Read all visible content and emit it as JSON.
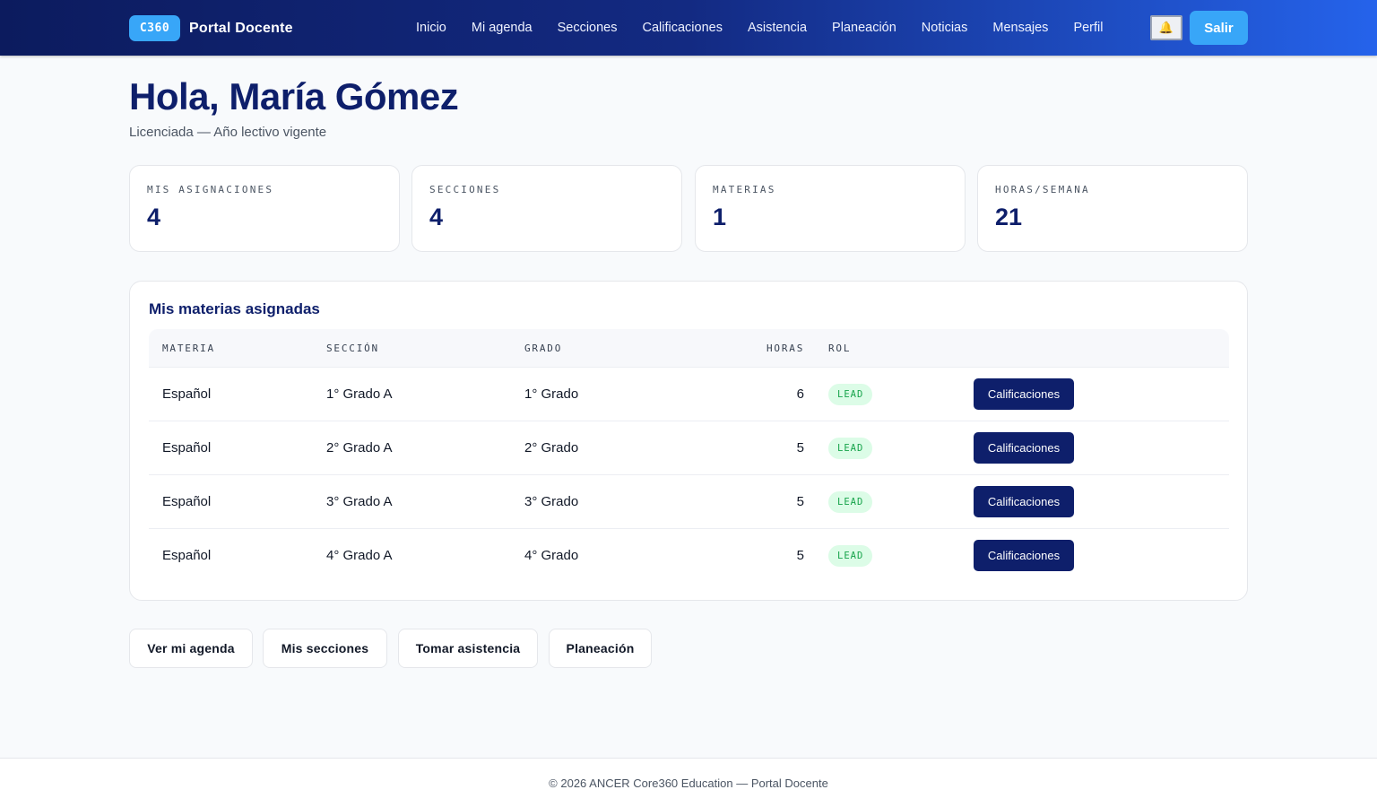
{
  "header": {
    "brand_badge": "C360",
    "brand_title": "Portal Docente",
    "nav": [
      "Inicio",
      "Mi agenda",
      "Secciones",
      "Calificaciones",
      "Asistencia",
      "Planeación",
      "Noticias",
      "Mensajes",
      "Perfil"
    ],
    "notifications_icon": "bell-icon",
    "logout_label": "Salir"
  },
  "greeting": {
    "title": "Hola, María Gómez",
    "subtitle": "Licenciada — Año lectivo vigente"
  },
  "stats": [
    {
      "label": "MIS ASIGNACIONES",
      "value": "4"
    },
    {
      "label": "SECCIONES",
      "value": "4"
    },
    {
      "label": "MATERIAS",
      "value": "1"
    },
    {
      "label": "HORAS/SEMANA",
      "value": "21"
    }
  ],
  "assignments": {
    "title": "Mis materias asignadas",
    "columns": [
      "MATERIA",
      "SECCIÓN",
      "GRADO",
      "HORAS",
      "ROL"
    ],
    "rows": [
      {
        "materia": "Español",
        "seccion": "1° Grado A",
        "grado": "1° Grado",
        "horas": "6",
        "rol": "LEAD",
        "action": "Calificaciones"
      },
      {
        "materia": "Español",
        "seccion": "2° Grado A",
        "grado": "2° Grado",
        "horas": "5",
        "rol": "LEAD",
        "action": "Calificaciones"
      },
      {
        "materia": "Español",
        "seccion": "3° Grado A",
        "grado": "3° Grado",
        "horas": "5",
        "rol": "LEAD",
        "action": "Calificaciones"
      },
      {
        "materia": "Español",
        "seccion": "4° Grado A",
        "grado": "4° Grado",
        "horas": "5",
        "rol": "LEAD",
        "action": "Calificaciones"
      }
    ]
  },
  "quick_actions": [
    "Ver mi agenda",
    "Mis secciones",
    "Tomar asistencia",
    "Planeación"
  ],
  "footer": {
    "text": "© 2026 ANCER Core360 Education — Portal Docente"
  },
  "colors": {
    "primary": "#0e1f6b",
    "accent": "#38a6f8",
    "badge_bg": "#dcfce7",
    "badge_text": "#16a34a"
  }
}
